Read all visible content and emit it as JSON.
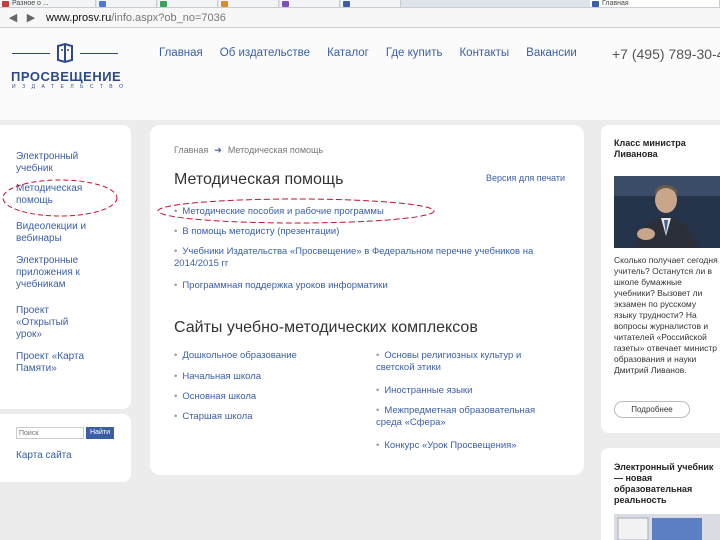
{
  "browser": {
    "tabs": [
      {
        "label": "Разное о ...",
        "color": "#c43d3d"
      },
      {
        "label": "",
        "color": "#4a7bd0"
      },
      {
        "label": "",
        "color": "#3aa05a"
      },
      {
        "label": "",
        "color": "#d98c2a"
      },
      {
        "label": "",
        "color": "#7a52b8"
      },
      {
        "label": "Главная",
        "color": "#3a5fa8"
      }
    ],
    "url_domain": "www.prosv.ru",
    "url_path": "/info.aspx?ob_no=7036"
  },
  "header": {
    "logo_name": "ПРОСВЕЩЕНИЕ",
    "logo_sub": "ИЗДАТЕЛЬСТВО",
    "nav": [
      "Главная",
      "Об издательстве",
      "Каталог",
      "Где купить",
      "Контакты",
      "Вакансии"
    ],
    "phone": "+7 (495) 789-30-4"
  },
  "sidebar": {
    "items": [
      {
        "label": "Электронный учебник"
      },
      {
        "label": "Методическая помощь"
      },
      {
        "label": "Видеолекции и вебинары"
      },
      {
        "label": "Электронные приложения к учебникам"
      },
      {
        "label": "Проект «Открытый урок»"
      },
      {
        "label": "Проект «Карта Памяти»"
      }
    ],
    "search_placeholder": "Поиск",
    "search_button": "Найти",
    "sitemap": "Карта сайта"
  },
  "main": {
    "breadcrumb": {
      "home": "Главная",
      "current": "Методическая помощь"
    },
    "title": "Методическая помощь",
    "print_version": "Версия для печати",
    "links": [
      "Методические пособия и рабочие программы",
      "В помощь методисту (презентации)",
      "Учебники Издательства «Просвещение» в Федеральном перечне учебников на 2014/2015 гг",
      "Программная поддержка уроков информатики"
    ],
    "section_title": "Сайты учебно-методических комплексов",
    "sites_left": [
      "Дошкольное образование",
      "Начальная школа",
      "Основная школа",
      "Старшая школа"
    ],
    "sites_right": [
      "Основы религиозных культур и светской этики",
      "Иностранные языки",
      "Межпредметная образовательная среда «Сфера»",
      "Конкурс «Урок Просвещения»"
    ]
  },
  "right": {
    "title": "Класс министра Ливанова",
    "text": "Сколько получает сегодня учитель? Останутся ли в школе бумажные учебники? Вызовет ли экзамен по русскому языку трудности? На вопросы журналистов и читателей «Российской газеты» отвечает министр образования и науки Дмитрий Ливанов.",
    "button": "Подробнее",
    "title2": "Электронный учебник — новая образовательная реальность"
  },
  "colors": {
    "link": "#3a5fa8",
    "annotation": "#c8102e",
    "brand": "#2c4a8a"
  }
}
